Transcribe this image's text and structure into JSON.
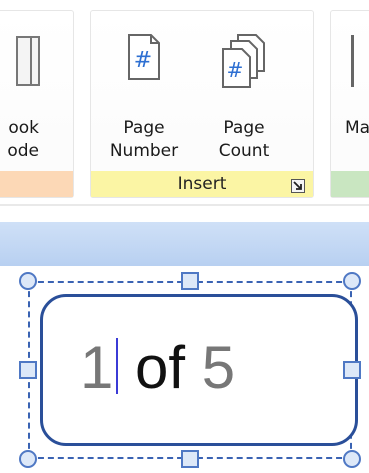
{
  "ribbon": {
    "left_group": {
      "button": {
        "label_line1": "ook",
        "label_line2": "ode",
        "icon": "book-mode-icon"
      }
    },
    "insert_group": {
      "label": "Insert",
      "buttons": [
        {
          "label_line1": "Page",
          "label_line2": "Number",
          "icon": "page-number-icon"
        },
        {
          "label_line1": "Page",
          "label_line2": "Count",
          "icon": "page-count-icon"
        }
      ],
      "launcher_icon": "dialog-launcher-icon"
    },
    "right_group": {
      "button": {
        "label": "Ma"
      }
    },
    "colors": {
      "left_footer": "#fcd8b6",
      "insert_footer": "#fbf5a4",
      "right_footer": "#c9e6c1"
    }
  },
  "document": {
    "field": {
      "current": "1",
      "separator": "of",
      "total": "5"
    }
  }
}
